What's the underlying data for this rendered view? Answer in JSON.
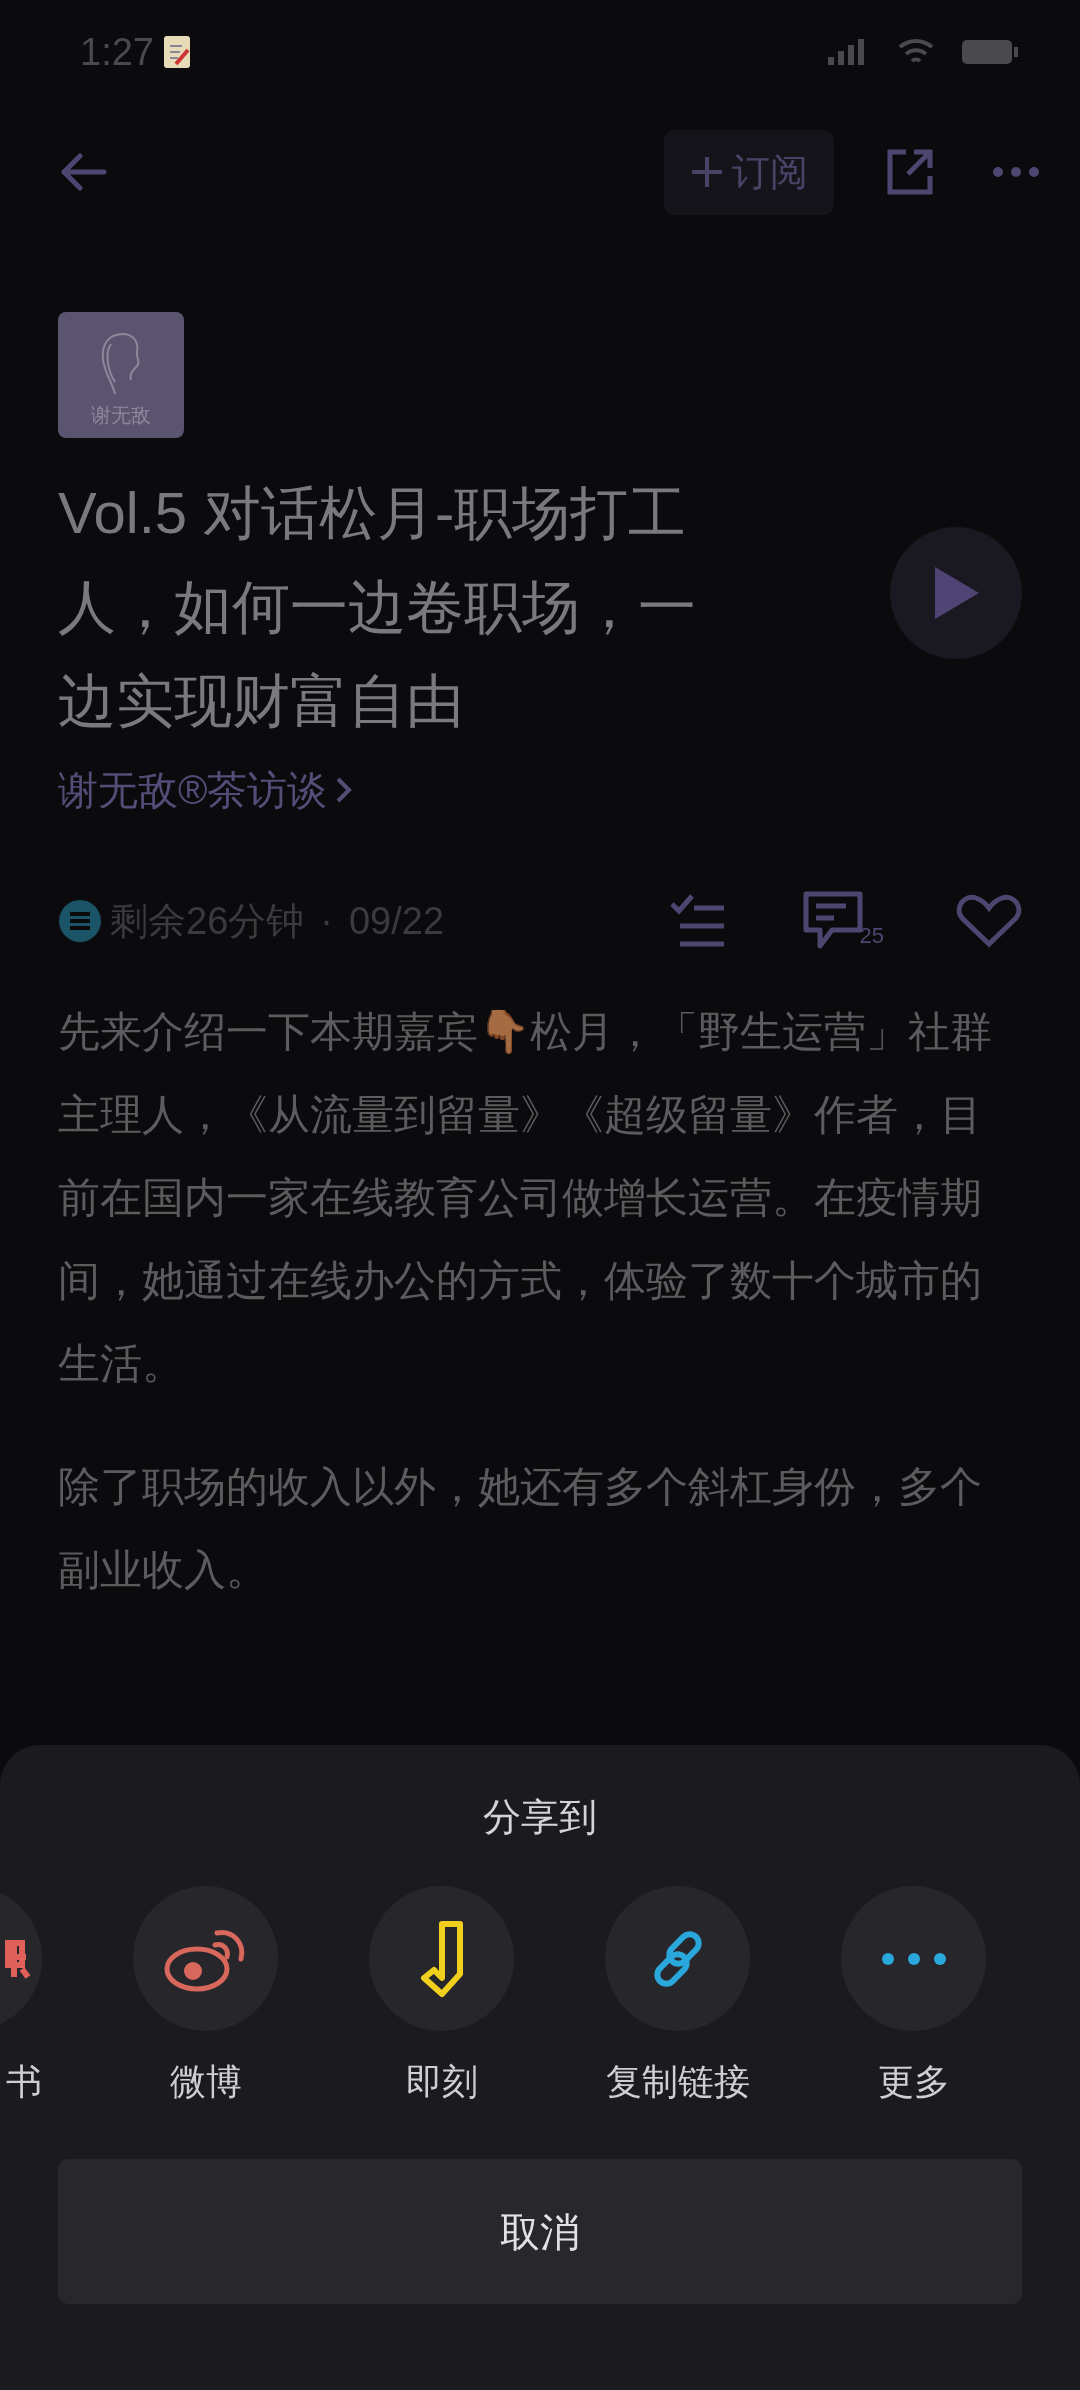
{
  "status_bar": {
    "time": "1:27"
  },
  "header": {
    "subscribe_label": "订阅"
  },
  "episode": {
    "cover_text": "谢无敌",
    "title": "Vol.5 对话松月-职场打工人，如何一边卷职场，一边实现财富自由",
    "podcast": "谢无敌®茶访谈"
  },
  "meta": {
    "remaining": "剩余26分钟",
    "separator": "·",
    "date": "09/22",
    "comment_count": "25"
  },
  "paragraphs": [
    "先来介绍一下本期嘉宾👇🏾松月，「野生运营」社群主理人，《从流量到留量》《超级留量》作者，目前在国内一家在线教育公司做增长运营。在疫情期间，她通过在线办公的方式，体验了数十个城市的生活。",
    "除了职场的收入以外，她还有多个斜杠身份，多个副业收入。"
  ],
  "share_sheet": {
    "title": "分享到",
    "items": [
      {
        "kind": "cut",
        "label": "书"
      },
      {
        "kind": "weibo",
        "label": "微博"
      },
      {
        "kind": "jike",
        "label": "即刻"
      },
      {
        "kind": "link",
        "label": "复制链接"
      },
      {
        "kind": "more",
        "label": "更多"
      }
    ],
    "cancel": "取消"
  }
}
